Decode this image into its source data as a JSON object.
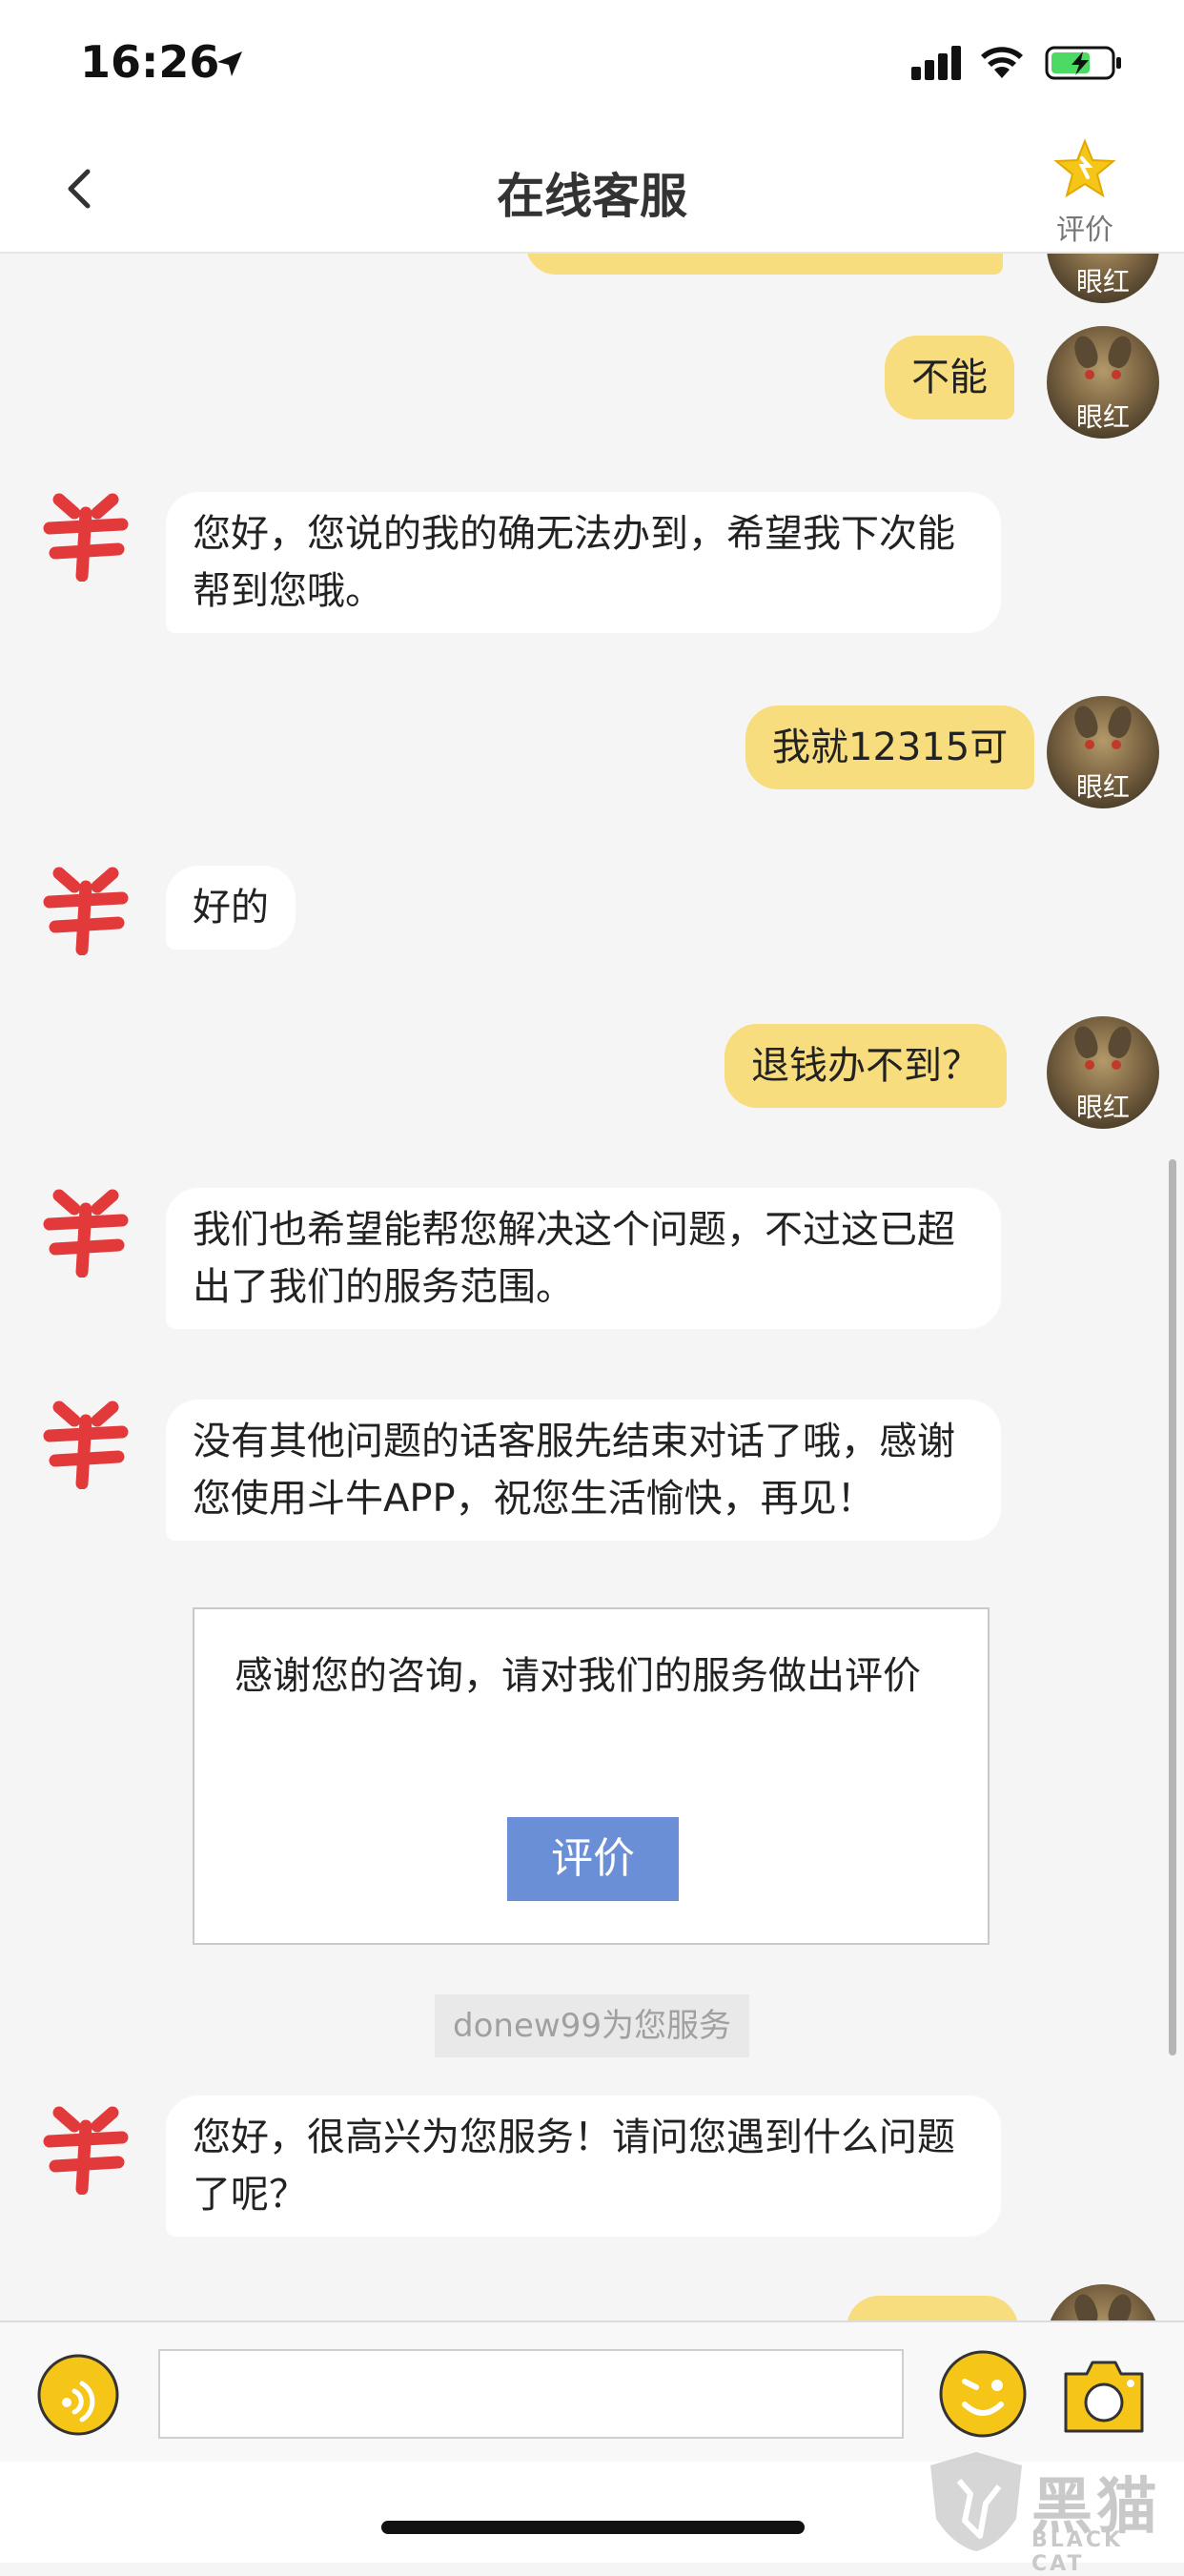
{
  "status_bar": {
    "time": "16:26"
  },
  "nav": {
    "title": "在线客服",
    "rate_label": "评价"
  },
  "user": {
    "nickname": "眼红"
  },
  "messages": [
    {
      "from": "user",
      "text": "不能"
    },
    {
      "from": "service",
      "text": "您好，您说的我的确无法办到，希望我下次能帮到您哦。"
    },
    {
      "from": "user",
      "text": "我就12315可"
    },
    {
      "from": "service",
      "text": "好的"
    },
    {
      "from": "user",
      "text": "退钱办不到？"
    },
    {
      "from": "service",
      "text": "我们也希望能帮您解决这个问题，不过这已超出了我们的服务范围。"
    },
    {
      "from": "service",
      "text": "没有其他问题的话客服先结束对话了哦，感谢您使用斗牛APP，祝您生活愉快，再见！"
    },
    {
      "from": "service",
      "text": "您好，很高兴为您服务！请问您遇到什么问题了呢？"
    }
  ],
  "rating_card": {
    "text": "感谢您的咨询，请对我们的服务做出评价",
    "button_label": "评价"
  },
  "agent_tag": "donew99为您服务",
  "input": {
    "placeholder": ""
  },
  "watermark": {
    "text": "黑猫",
    "sub": "BLACK CAT"
  },
  "colors": {
    "user_bubble": "#f8dd7e",
    "service_bubble": "#ffffff",
    "accent": "#f5c518",
    "rate_button": "#6b8fd6",
    "service_logo": "#e23a3a"
  }
}
